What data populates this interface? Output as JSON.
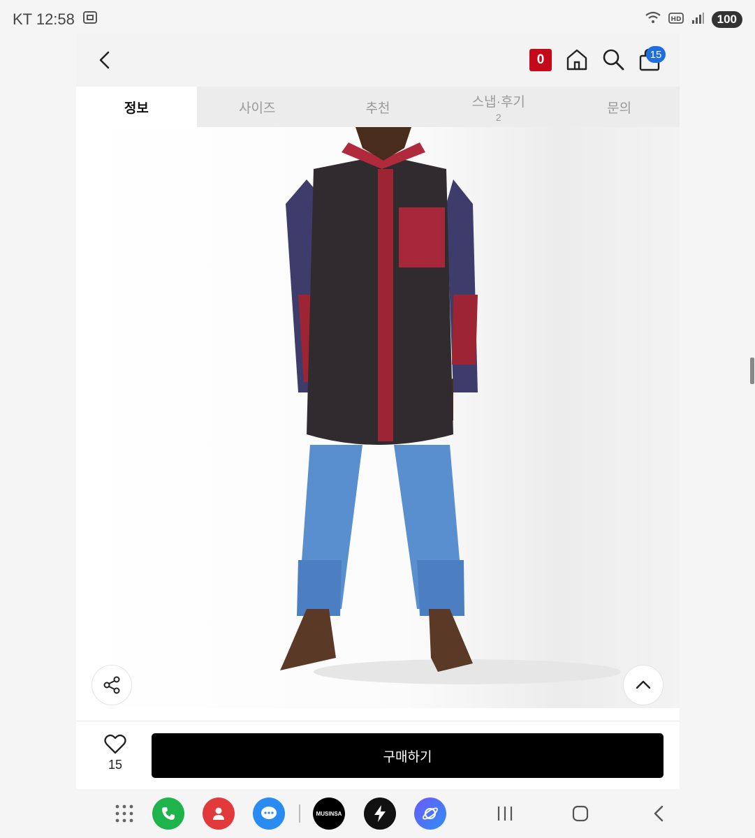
{
  "status_bar": {
    "carrier_time": "KT 12:58",
    "battery": "100"
  },
  "header": {
    "coupon_count": "0",
    "cart_count": "15"
  },
  "tabs": [
    {
      "label": "정보",
      "sub": ""
    },
    {
      "label": "사이즈",
      "sub": ""
    },
    {
      "label": "추천",
      "sub": ""
    },
    {
      "label": "스냅·후기",
      "sub": "2"
    },
    {
      "label": "문의",
      "sub": ""
    }
  ],
  "purchase_bar": {
    "like_count": "15",
    "buy_label": "구매하기"
  },
  "dock": {
    "musinsa_label": "MUSINSA"
  },
  "colors": {
    "accent_red": "#c40a1a",
    "badge_blue": "#1f6ee0",
    "buy_button": "#000000"
  }
}
